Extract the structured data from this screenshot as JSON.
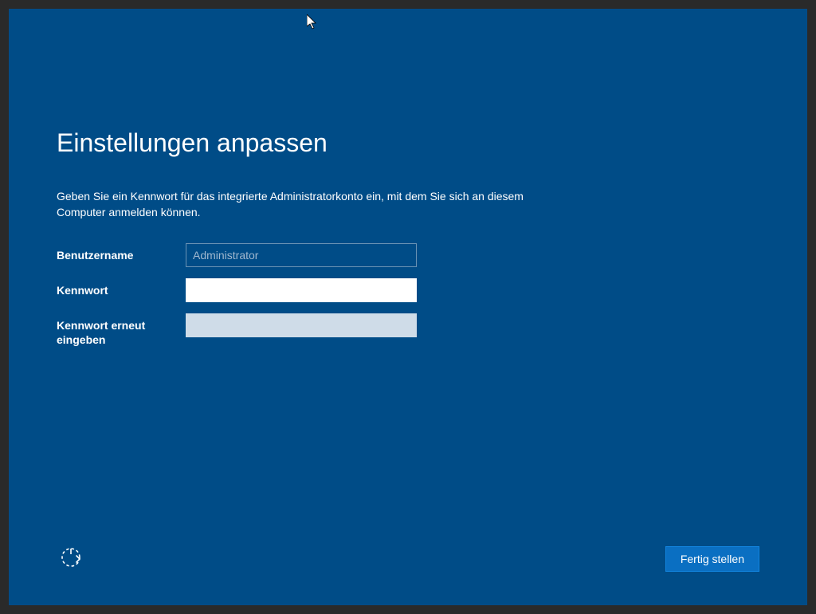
{
  "page": {
    "title": "Einstellungen anpassen",
    "description": "Geben Sie ein Kennwort für das integrierte Administratorkonto ein, mit dem Sie sich an diesem Computer anmelden können."
  },
  "form": {
    "username_label": "Benutzername",
    "username_value": "Administrator",
    "password_label": "Kennwort",
    "password_value": "",
    "confirm_label": "Kennwort erneut eingeben",
    "confirm_value": ""
  },
  "actions": {
    "finish_label": "Fertig stellen"
  }
}
